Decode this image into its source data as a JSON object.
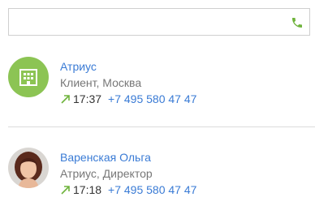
{
  "search": {
    "value": "",
    "placeholder": ""
  },
  "colors": {
    "accent_green": "#6fb33c",
    "link_blue": "#3a7bd5",
    "company_avatar_bg": "#8cc454"
  },
  "contacts": [
    {
      "name": "Атриус",
      "subtitle": "Клиент, Москва",
      "call_direction": "outgoing-arrow-icon",
      "time": "17:37",
      "phone": "+7 495 580 47 47",
      "avatar_icon": "building-icon"
    },
    {
      "name": "Варенская Ольга",
      "subtitle": "Атриус, Директор",
      "call_direction": "outgoing-arrow-icon",
      "time": "17:18",
      "phone": "+7 495 580 47 47",
      "avatar_icon": "person-photo"
    }
  ]
}
